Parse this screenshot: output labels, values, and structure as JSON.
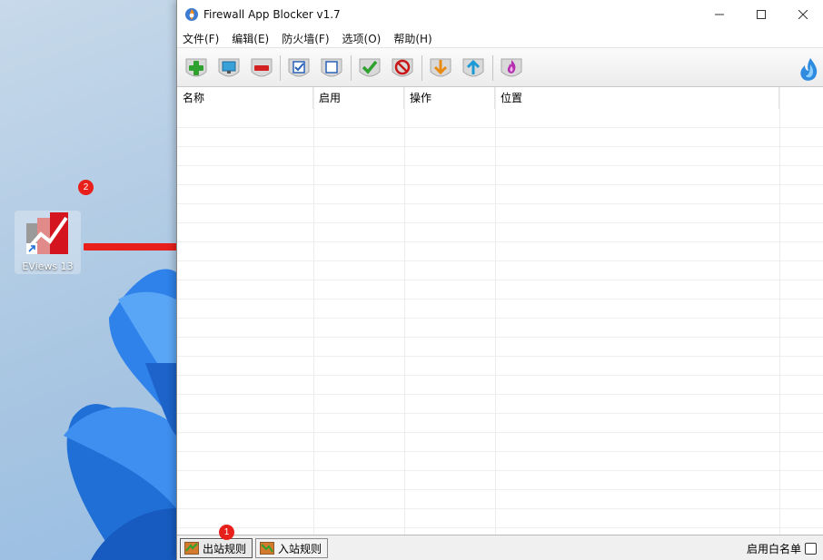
{
  "window": {
    "title": "Firewall App Blocker v1.7"
  },
  "menu": [
    "文件(F)",
    "编辑(E)",
    "防火墙(F)",
    "选项(O)",
    "帮助(H)"
  ],
  "toolbar": {
    "buttons": [
      {
        "name": "add-app-button",
        "icon": "green-plus-icon"
      },
      {
        "name": "add-screen-button",
        "icon": "monitor-icon"
      },
      {
        "name": "remove-button",
        "icon": "red-minus-icon"
      },
      {
        "name": "select-all-button",
        "icon": "checked-box-icon"
      },
      {
        "name": "deselect-button",
        "icon": "empty-box-icon"
      },
      {
        "name": "allow-button",
        "icon": "green-check-icon"
      },
      {
        "name": "block-button",
        "icon": "red-block-icon"
      },
      {
        "name": "import-button",
        "icon": "orange-down-arrow-icon"
      },
      {
        "name": "export-button",
        "icon": "blue-up-arrow-icon"
      },
      {
        "name": "firewall-button",
        "icon": "purple-flame-icon"
      }
    ]
  },
  "table": {
    "columns": [
      "名称",
      "启用",
      "操作",
      "位置"
    ],
    "rows": []
  },
  "statusbar": {
    "tab_outbound": "出站规则",
    "tab_inbound": "入站规则",
    "whitelist_label": "启用白名单",
    "whitelist_checked": false
  },
  "desktop": {
    "icon_label": "EViews 13",
    "badge_1": "1",
    "badge_2": "2"
  },
  "colors": {
    "badge": "#e8201b",
    "arrow": "#e8201b",
    "accent": "#0078d4"
  }
}
